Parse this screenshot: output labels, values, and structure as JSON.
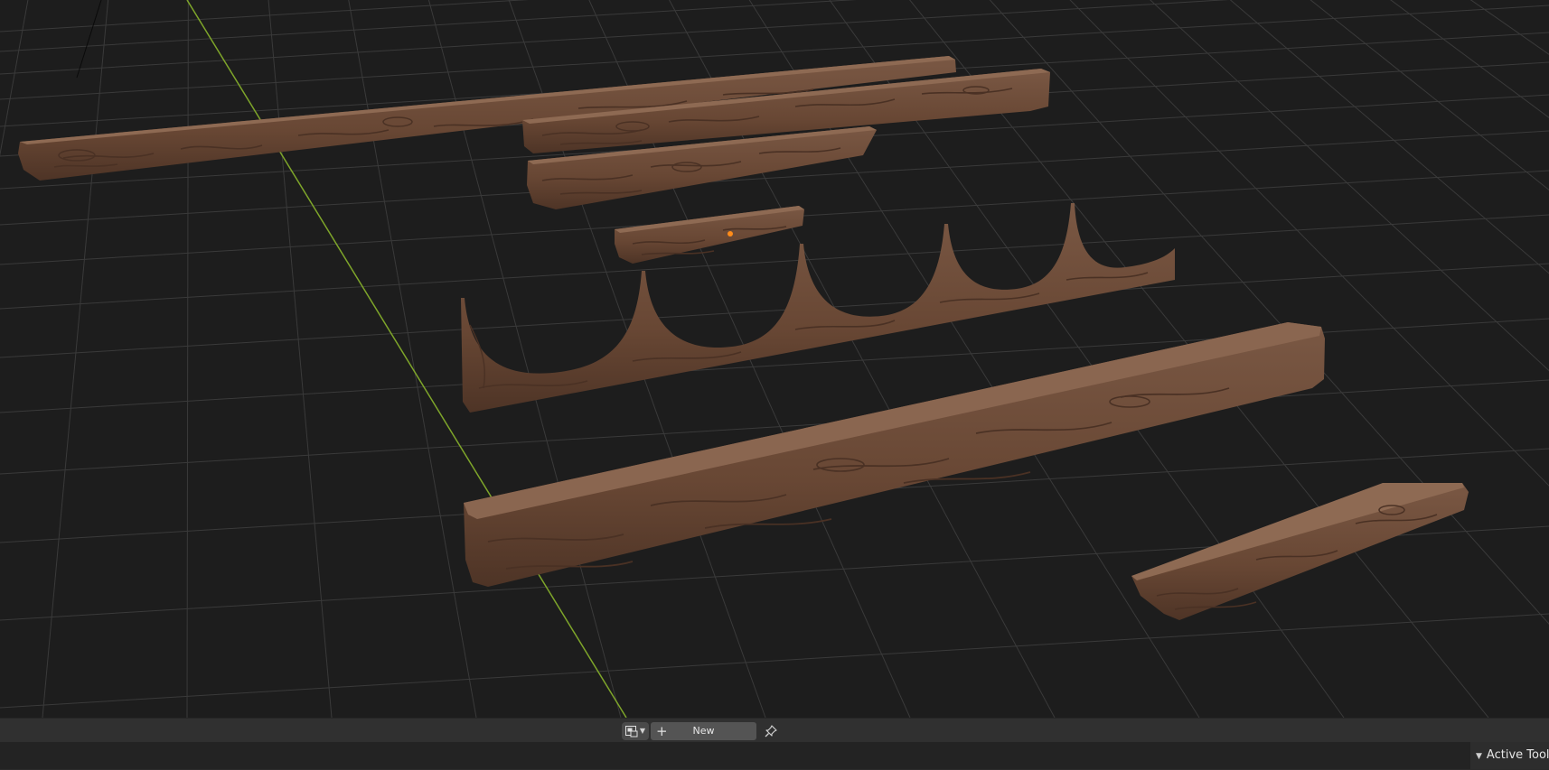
{
  "viewport": {
    "objects": [
      "long-plank",
      "upper-plank",
      "middle-plank",
      "small-plank",
      "scalloped-trim",
      "large-beam",
      "short-plank"
    ]
  },
  "header": {
    "editor_type_icon": "image-editor-icon",
    "new_label": "New",
    "pin_icon": "pin-icon"
  },
  "sidebar_tab": {
    "label": "Active Tool"
  },
  "colors": {
    "viewport_bg": "#1d1d1d",
    "grid": "#3a3a3a",
    "y_axis": "#7ea52a",
    "wood": "#76543e",
    "wood_dark": "#4a3124",
    "origin": "#ff8c1a"
  }
}
